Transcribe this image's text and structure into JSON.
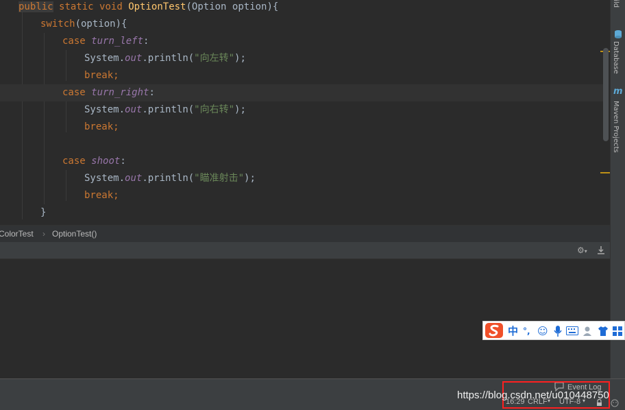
{
  "editor": {
    "lines": [
      {
        "tokens": [
          {
            "t": "public",
            "c": "kw sel"
          },
          {
            "t": " ",
            "c": "plain"
          },
          {
            "t": "static",
            "c": "kw"
          },
          {
            "t": " ",
            "c": "plain"
          },
          {
            "t": "void",
            "c": "kw"
          },
          {
            "t": " ",
            "c": "plain"
          },
          {
            "t": "OptionTest",
            "c": "fn"
          },
          {
            "t": "(Option option){",
            "c": "plain"
          }
        ]
      },
      {
        "tokens": [
          {
            "t": "switch",
            "c": "kw"
          },
          {
            "t": "(option){",
            "c": "plain"
          }
        ]
      },
      {
        "tokens": [
          {
            "t": "case",
            "c": "kw"
          },
          {
            "t": " ",
            "c": "plain"
          },
          {
            "t": "turn_left",
            "c": "cst"
          },
          {
            "t": ":",
            "c": "plain"
          }
        ]
      },
      {
        "tokens": [
          {
            "t": "System.",
            "c": "plain"
          },
          {
            "t": "out",
            "c": "cst"
          },
          {
            "t": ".println(",
            "c": "plain"
          },
          {
            "t": "\"向左转\"",
            "c": "str"
          },
          {
            "t": ");",
            "c": "plain"
          }
        ]
      },
      {
        "tokens": [
          {
            "t": "break",
            "c": "kw"
          },
          {
            "t": ";",
            "c": "kw"
          }
        ]
      },
      {
        "tokens": [
          {
            "t": "case",
            "c": "kw"
          },
          {
            "t": " ",
            "c": "plain"
          },
          {
            "t": "turn_right",
            "c": "cst"
          },
          {
            "t": ":",
            "c": "plain"
          }
        ]
      },
      {
        "tokens": [
          {
            "t": "System.",
            "c": "plain"
          },
          {
            "t": "out",
            "c": "cst"
          },
          {
            "t": ".println(",
            "c": "plain"
          },
          {
            "t": "\"向右转\"",
            "c": "str"
          },
          {
            "t": ");",
            "c": "plain"
          }
        ]
      },
      {
        "tokens": [
          {
            "t": "break",
            "c": "kw"
          },
          {
            "t": ";",
            "c": "kw"
          }
        ]
      },
      {
        "tokens": []
      },
      {
        "tokens": [
          {
            "t": "case",
            "c": "kw"
          },
          {
            "t": " ",
            "c": "plain"
          },
          {
            "t": "shoot",
            "c": "cst"
          },
          {
            "t": ":",
            "c": "plain"
          }
        ]
      },
      {
        "tokens": [
          {
            "t": "System.",
            "c": "plain"
          },
          {
            "t": "out",
            "c": "cst"
          },
          {
            "t": ".println(",
            "c": "plain"
          },
          {
            "t": "\"瞄准射击\"",
            "c": "str"
          },
          {
            "t": ");",
            "c": "plain"
          }
        ]
      },
      {
        "tokens": [
          {
            "t": "break",
            "c": "kw"
          },
          {
            "t": ";",
            "c": "kw"
          }
        ]
      },
      {
        "tokens": [
          {
            "t": "}",
            "c": "plain"
          }
        ]
      }
    ]
  },
  "right_toolbar": {
    "build_label": "Build",
    "database_label": "Database",
    "maven_label": "Maven Projects"
  },
  "breadcrumb": {
    "class_name": "ColorTest",
    "method_name": "OptionTest()"
  },
  "ime": {
    "lang": "中",
    "punct": "°,"
  },
  "status": {
    "event_log": "Event Log",
    "position": "16:29",
    "line_sep": "CRLF",
    "encoding": "UTF-8"
  },
  "watermark": "https://blog.csdn.net/u010448750",
  "colors": {
    "keyword": "#cc7832",
    "function": "#ffc66d",
    "constant": "#9876aa",
    "string": "#6a8759",
    "text": "#a9b7c6",
    "highlight_box": "#ff2020"
  }
}
